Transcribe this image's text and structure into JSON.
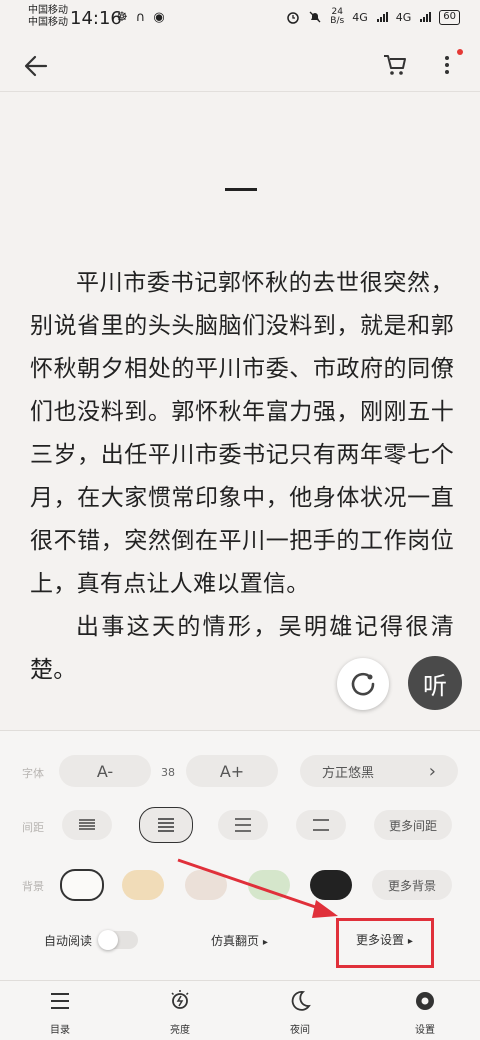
{
  "status_bar": {
    "carrier1": "中国移动",
    "carrier2": "中国移动",
    "time": "14:16",
    "left_icons": "☸ ∩ ◉",
    "speed_value": "24",
    "speed_unit": "B/s",
    "signal1": "4G",
    "signal2": "4G",
    "battery": "60"
  },
  "top_bar": {
    "back_icon": "back-arrow-icon",
    "cart_icon": "cart-icon",
    "more_icon": "more-vertical-icon"
  },
  "reading": {
    "chapter_mark": "一",
    "paragraph1": "平川市委书记郭怀秋的去世很突然，别说省里的头头脑脑们没料到，就是和郭怀秋朝夕相处的平川市委、市政府的同僚们也没料到。郭怀秋年富力强，刚刚五十三岁，出任平川市委书记只有两年零七个月，在大家惯常印象中，他身体状况一直很不错，突然倒在平川一把手的工作岗位上，真有点让人难以置信。",
    "paragraph2": "出事这天的情形，吴明雄记得很清楚。"
  },
  "floating": {
    "listen_label": "听"
  },
  "settings": {
    "font_label": "字体",
    "font_decrease": "A-",
    "font_size": "38",
    "font_increase": "A+",
    "font_name": "方正悠黑",
    "font_name_chevron": "›",
    "spacing_label": "间距",
    "more_spacing": "更多间距",
    "background_label": "背景",
    "more_background": "更多背景",
    "auto_read_label": "自动阅读",
    "page_turn": "仿真翻页",
    "page_turn_arrow": "▸",
    "more_settings": "更多设置",
    "more_settings_arrow": "▸",
    "swatch_colors": [
      "#fbfaf8",
      "#f1dcb8",
      "#ebe0d8",
      "#d5e6cb",
      "#222222"
    ]
  },
  "bottom_nav": {
    "catalog": "目录",
    "brightness": "亮度",
    "night": "夜间",
    "settings": "设置"
  }
}
